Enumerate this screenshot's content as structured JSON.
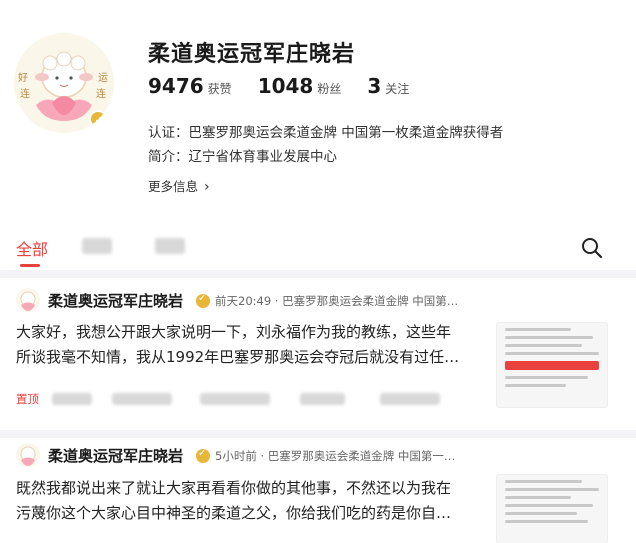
{
  "profile": {
    "name": "柔道奥运冠军庄晓岩",
    "avatar_chars": [
      "好",
      "运",
      "连",
      "连"
    ],
    "stats": [
      {
        "value": "9476",
        "label": "获赞"
      },
      {
        "value": "1048",
        "label": "粉丝"
      },
      {
        "value": "3",
        "label": "关注"
      }
    ],
    "certification": "认证：巴塞罗那奥运会柔道金牌 中国第一枚柔道金牌获得者",
    "intro": "简介：辽宁省体育事业发展中心",
    "more_label": "更多信息",
    "more_arrow": "›"
  },
  "tabs": {
    "all_label": "全部",
    "active_color": "#e8413e",
    "search_icon": "search-icon"
  },
  "posts": [
    {
      "author": "柔道奥运冠军庄晓岩",
      "meta": "前天20:49 · 巴塞罗那奥运会柔道金牌 中国第…",
      "text_line1": "大家好，我想公开跟大家说明一下，刘永福作为我的教练，这些年",
      "text_line2": "所谈我毫不知情，我从1992年巴塞罗那奥运会夺冠后就没有过任…",
      "pin_label": "置顶"
    },
    {
      "author": "柔道奥运冠军庄晓岩",
      "meta": "5小时前 · 巴塞罗那奥运会柔道金牌 中国第一…",
      "text_line1": "既然我都说出来了就让大家再看看你做的其他事，不然还以为我在",
      "text_line2": "污蔑你这个大家心目中神圣的柔道之父，你给我们吃的药是你自…"
    }
  ]
}
